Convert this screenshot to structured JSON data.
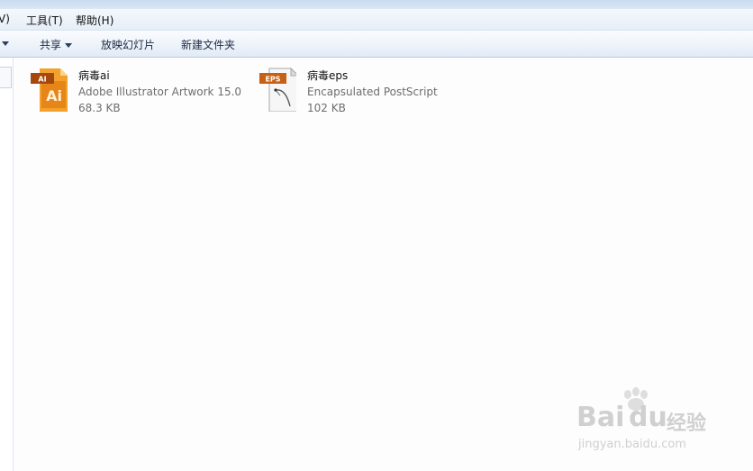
{
  "menu": {
    "view_partial": "V)",
    "tools": "工具(T)",
    "help": "帮助(H)"
  },
  "toolbar": {
    "share": "共享",
    "slideshow": "放映幻灯片",
    "new_folder": "新建文件夹"
  },
  "files": [
    {
      "name": "病毒ai",
      "type": "Adobe Illustrator Artwork 15.0",
      "size": "68.3 KB",
      "icon": "adobe-illustrator-file-icon",
      "icon_badge": "AI",
      "icon_label": "Ai"
    },
    {
      "name": "病毒eps",
      "type": "Encapsulated PostScript",
      "size": "102 KB",
      "icon": "eps-file-icon",
      "icon_badge": "EPS"
    }
  ],
  "watermark": {
    "brand": "Bai",
    "brand2": "du",
    "cn": "经验",
    "url": "jingyan.baidu.com"
  },
  "colors": {
    "ai_orange": "#e8891c",
    "eps_orange": "#d76a16",
    "toolbar_bg": "#e9f0f9"
  }
}
